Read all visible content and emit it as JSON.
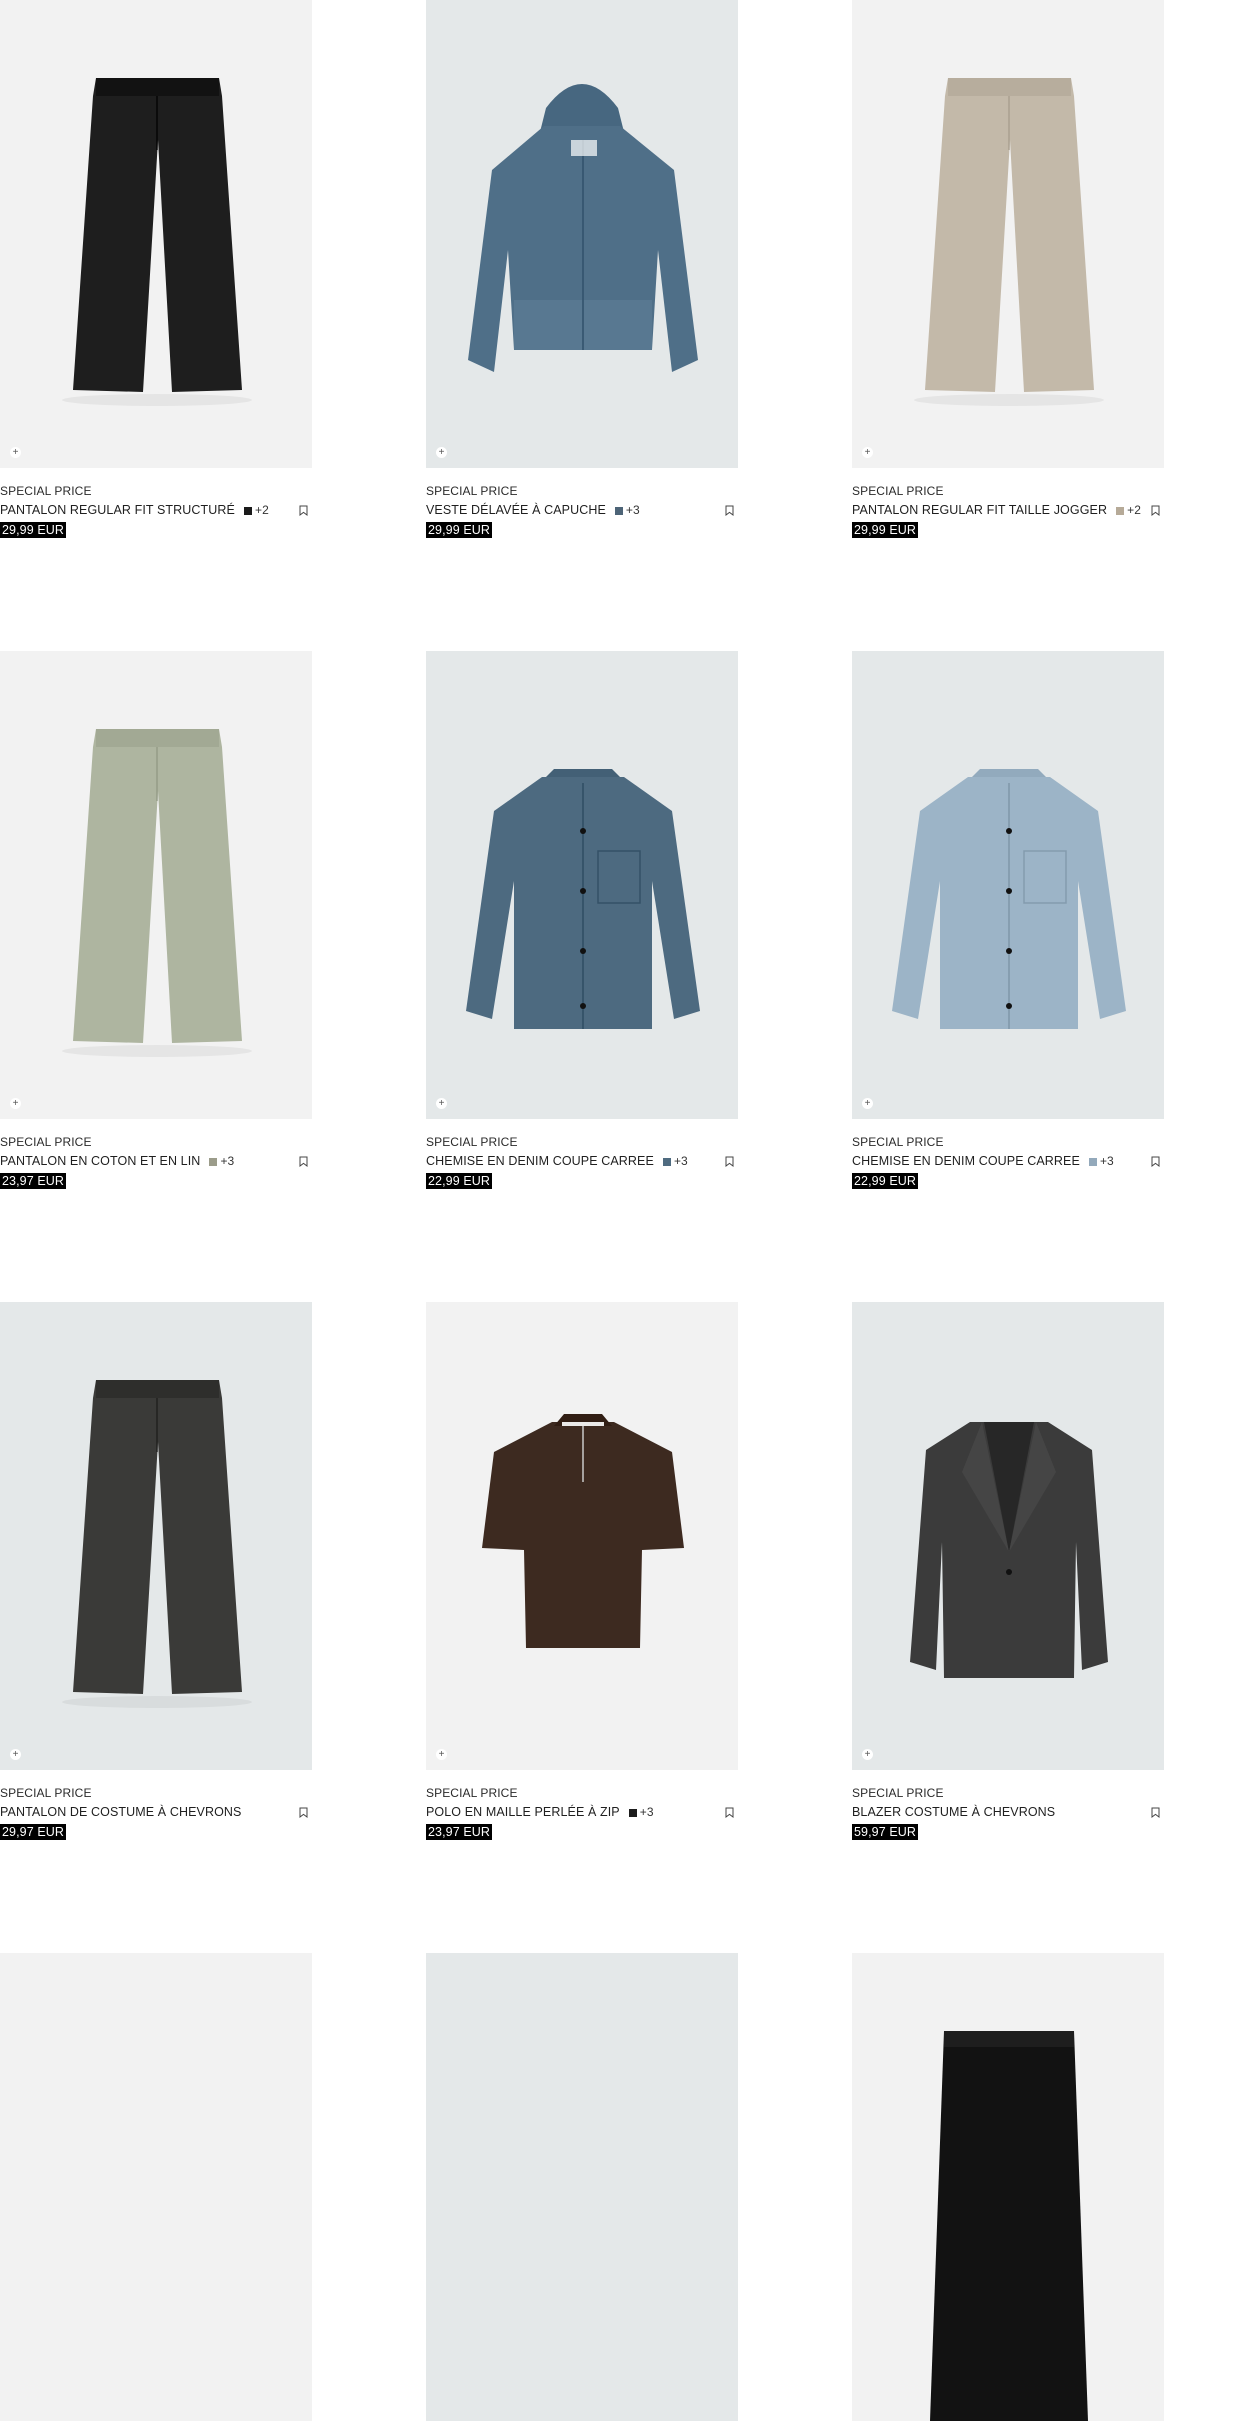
{
  "products": [
    {
      "special": "SPECIAL PRICE",
      "name": "PANTALON REGULAR FIT STRUCTURÉ",
      "swatch": "#1a1a1a",
      "more": "+2",
      "price": "29,99 EUR",
      "bg": "grey",
      "garment": "trousers",
      "color": "#1e1e1e"
    },
    {
      "special": "SPECIAL PRICE",
      "name": "VESTE DÉLAVÉE À CAPUCHE",
      "swatch": "#4d6477",
      "more": "+3",
      "price": "29,99 EUR",
      "bg": "blue",
      "garment": "hoodie-jacket",
      "color": "#4f6f88"
    },
    {
      "special": "SPECIAL PRICE",
      "name": "PANTALON REGULAR FIT TAILLE JOGGER",
      "swatch": "#b6aa98",
      "more": "+2",
      "price": "29,99 EUR",
      "bg": "grey",
      "garment": "trousers",
      "color": "#c3b9a9"
    },
    {
      "special": "SPECIAL PRICE",
      "name": "PANTALON EN COTON ET EN LIN",
      "swatch": "#9b9c8a",
      "more": "+3",
      "price": "23,97 EUR",
      "bg": "grey",
      "garment": "trousers",
      "color": "#aeb5a0"
    },
    {
      "special": "SPECIAL PRICE",
      "name": "CHEMISE EN DENIM COUPE CARREE",
      "swatch": "#4f6b80",
      "more": "+3",
      "price": "22,99 EUR",
      "bg": "blue",
      "garment": "shirt",
      "color": "#4d6a80"
    },
    {
      "special": "SPECIAL PRICE",
      "name": "CHEMISE EN DENIM COUPE CARREE",
      "swatch": "#93a9bb",
      "more": "+3",
      "price": "22,99 EUR",
      "bg": "blue",
      "garment": "shirt",
      "color": "#9cb4c7"
    },
    {
      "special": "SPECIAL PRICE",
      "name": "PANTALON DE COSTUME À CHEVRONS",
      "swatch": "",
      "more": "",
      "price": "29,97 EUR",
      "bg": "blue",
      "garment": "trousers",
      "color": "#3a3a38"
    },
    {
      "special": "SPECIAL PRICE",
      "name": "POLO EN MAILLE PERLÉE À ZIP",
      "swatch": "#1c1c1c",
      "more": "+3",
      "price": "23,97 EUR",
      "bg": "grey",
      "garment": "polo",
      "color": "#3d2a20"
    },
    {
      "special": "SPECIAL PRICE",
      "name": "BLAZER COSTUME À CHEVRONS",
      "swatch": "",
      "more": "",
      "price": "59,97 EUR",
      "bg": "blue",
      "garment": "blazer",
      "color": "#3b3b3b"
    },
    {
      "special": "",
      "name": "",
      "swatch": "",
      "more": "",
      "price": "",
      "bg": "grey",
      "garment": "none",
      "color": ""
    },
    {
      "special": "",
      "name": "",
      "swatch": "",
      "more": "",
      "price": "",
      "bg": "blue",
      "garment": "none",
      "color": ""
    },
    {
      "special": "",
      "name": "",
      "swatch": "",
      "more": "",
      "price": "",
      "bg": "grey",
      "garment": "shorts",
      "color": "#121212"
    }
  ],
  "icons": {
    "add": "plus-icon",
    "save": "bookmark-icon"
  }
}
